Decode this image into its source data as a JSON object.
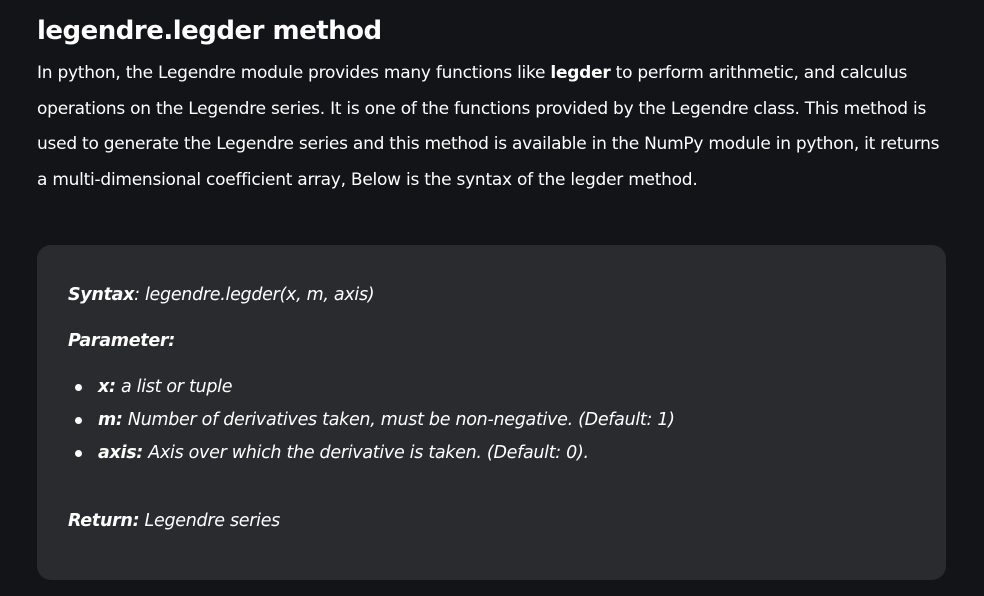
{
  "article": {
    "title": "legendre.legder method",
    "intro": {
      "before": "In python, the Legendre module provides many functions like ",
      "keyword": "legder",
      "after": " to perform arithmetic, and calculus operations on the Legendre series. It is one of the functions provided by the Legendre class. This method is used to generate the Legendre series and this method is available in the NumPy module in python, it returns a multi-dimensional coefficient array, Below is the syntax of the legder method."
    }
  },
  "syntax_box": {
    "syntax_label": "Syntax",
    "syntax_value": ": legendre.legder(x, m, axis)",
    "parameter_heading": "Parameter:",
    "parameters": [
      {
        "name": "x:",
        "description": " a list or tuple"
      },
      {
        "name": "m:",
        "description": " Number of derivatives taken, must be non-negative. (Default: 1)"
      },
      {
        "name": "axis:",
        "description": " Axis over which the derivative is taken. (Default: 0)."
      }
    ],
    "return_label": "Return:",
    "return_value": " Legendre series"
  }
}
